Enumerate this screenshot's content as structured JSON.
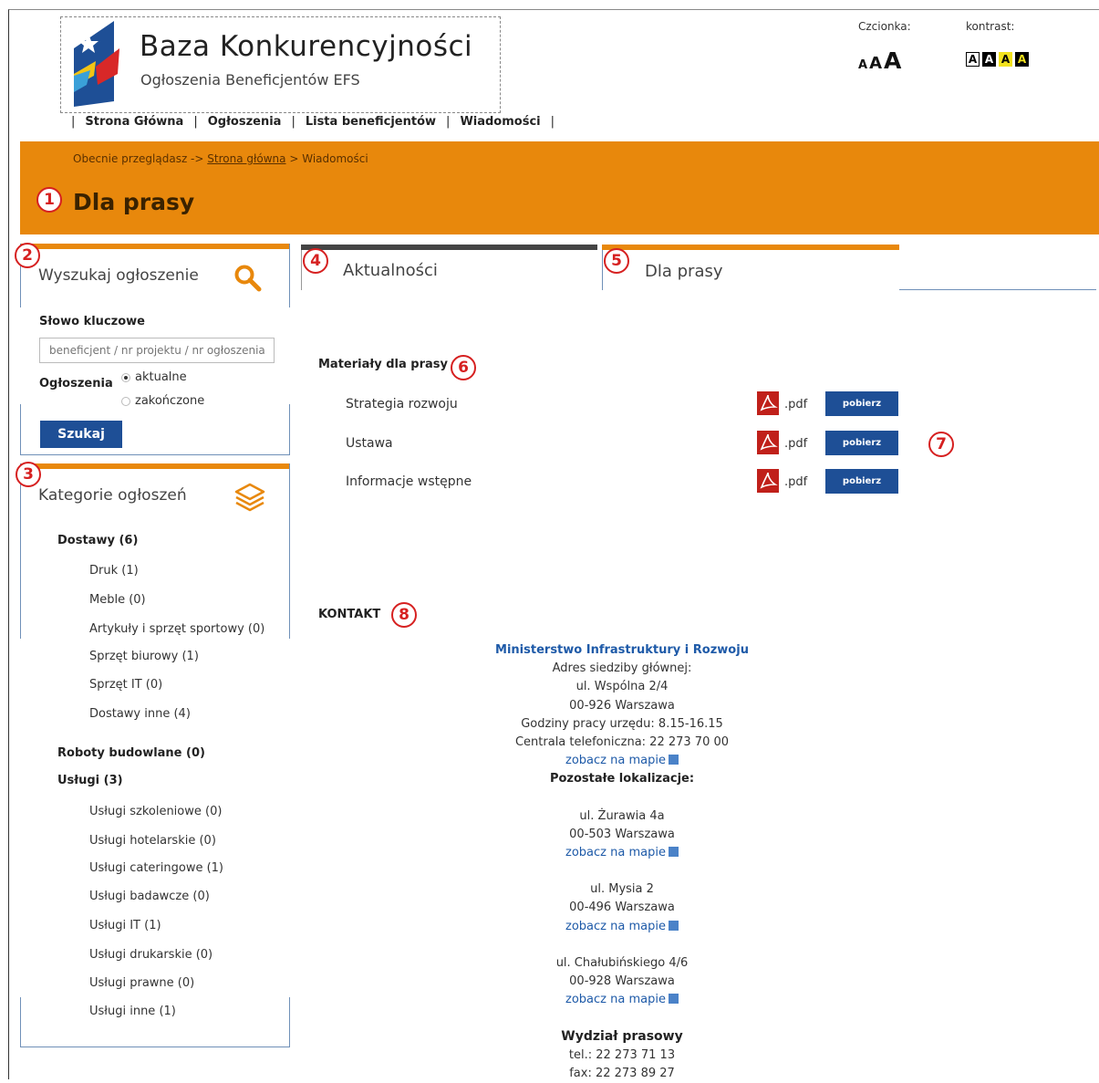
{
  "logo": {
    "title": "Baza Konkurencyjności",
    "subtitle": "Ogłoszenia Beneficjentów EFS"
  },
  "topnav": {
    "items": [
      "Strona Główna",
      "Ogłoszenia",
      "Lista beneficjentów",
      "Wiadomości"
    ],
    "separator": "|"
  },
  "tools": {
    "font_label": "Czcionka:",
    "font_sizes": [
      "A",
      "A",
      "A"
    ],
    "contrast_label": "kontrast:",
    "contrast_options": [
      "A",
      "A",
      "A",
      "A"
    ]
  },
  "breadcrumb": {
    "prefix": "Obecnie przeglądasz ->",
    "home": "Strona główna",
    "separator": ">",
    "current": "Wiadomości"
  },
  "page_title": "Dla prasy",
  "markers": [
    "1",
    "2",
    "3",
    "4",
    "5",
    "6",
    "7",
    "8"
  ],
  "search": {
    "title": "Wyszukaj ogłoszenie",
    "keyword_label": "Słowo kluczowe",
    "placeholder": "beneficjent / nr projektu / nr ogłoszenia",
    "status_label": "Ogłoszenia",
    "options": [
      "aktualne",
      "zakończone"
    ],
    "button": "Szukaj"
  },
  "categories": {
    "title": "Kategorie ogłoszeń",
    "groups": [
      {
        "name": "Dostawy (6)",
        "items": [
          "Druk (1)",
          "Meble (0)",
          "Artykuły i sprzęt sportowy (0)",
          "Sprzęt biurowy (1)",
          "Sprzęt IT (0)",
          "Dostawy inne (4)"
        ]
      },
      {
        "name": "Roboty budowlane (0)",
        "items": []
      },
      {
        "name": "Usługi (3)",
        "items": [
          "Usługi szkoleniowe (0)",
          "Usługi hotelarskie (0)",
          "Usługi cateringowe (1)",
          "Usługi badawcze (0)",
          "Usługi IT (1)",
          "Usługi drukarskie (0)",
          "Usługi prawne (0)",
          "Usługi inne (1)"
        ]
      }
    ]
  },
  "tabs": [
    "Aktualności",
    "Dla prasy"
  ],
  "materials": {
    "title": "Materiały dla prasy",
    "rows": [
      {
        "name": "Strategia rozwoju",
        "ext": ".pdf",
        "button": "pobierz"
      },
      {
        "name": "Ustawa",
        "ext": ".pdf",
        "button": "pobierz"
      },
      {
        "name": "Informacje wstępne",
        "ext": ".pdf",
        "button": "pobierz"
      }
    ]
  },
  "contact": {
    "title": "KONTAKT",
    "org": "Ministerstwo Infrastruktury i Rozwoju",
    "hq_label": "Adres siedziby głównej:",
    "hq_street": "ul. Wspólna 2/4",
    "hq_city": "00-926 Warszawa",
    "hours": "Godziny pracy urzędu: 8.15-16.15",
    "phone": "Centrala telefoniczna: 22 273 70 00",
    "map_link": "zobacz na mapie",
    "other_label": "Pozostałe lokalizacje:",
    "locations": [
      {
        "street": "ul. Żurawia 4a",
        "city": "00-503 Warszawa"
      },
      {
        "street": "ul. Mysia 2",
        "city": "00-496 Warszawa"
      },
      {
        "street": "ul. Chałubińskiego 4/6",
        "city": "00-928 Warszawa"
      }
    ],
    "press_label": "Wydział prasowy",
    "press_tel": "tel.: 22 273 71 13",
    "press_fax": "fax: 22 273 89 27"
  },
  "colors": {
    "accent": "#e8880c",
    "button": "#1e4f96",
    "link": "#1e5aa8",
    "marker": "#d62020"
  }
}
